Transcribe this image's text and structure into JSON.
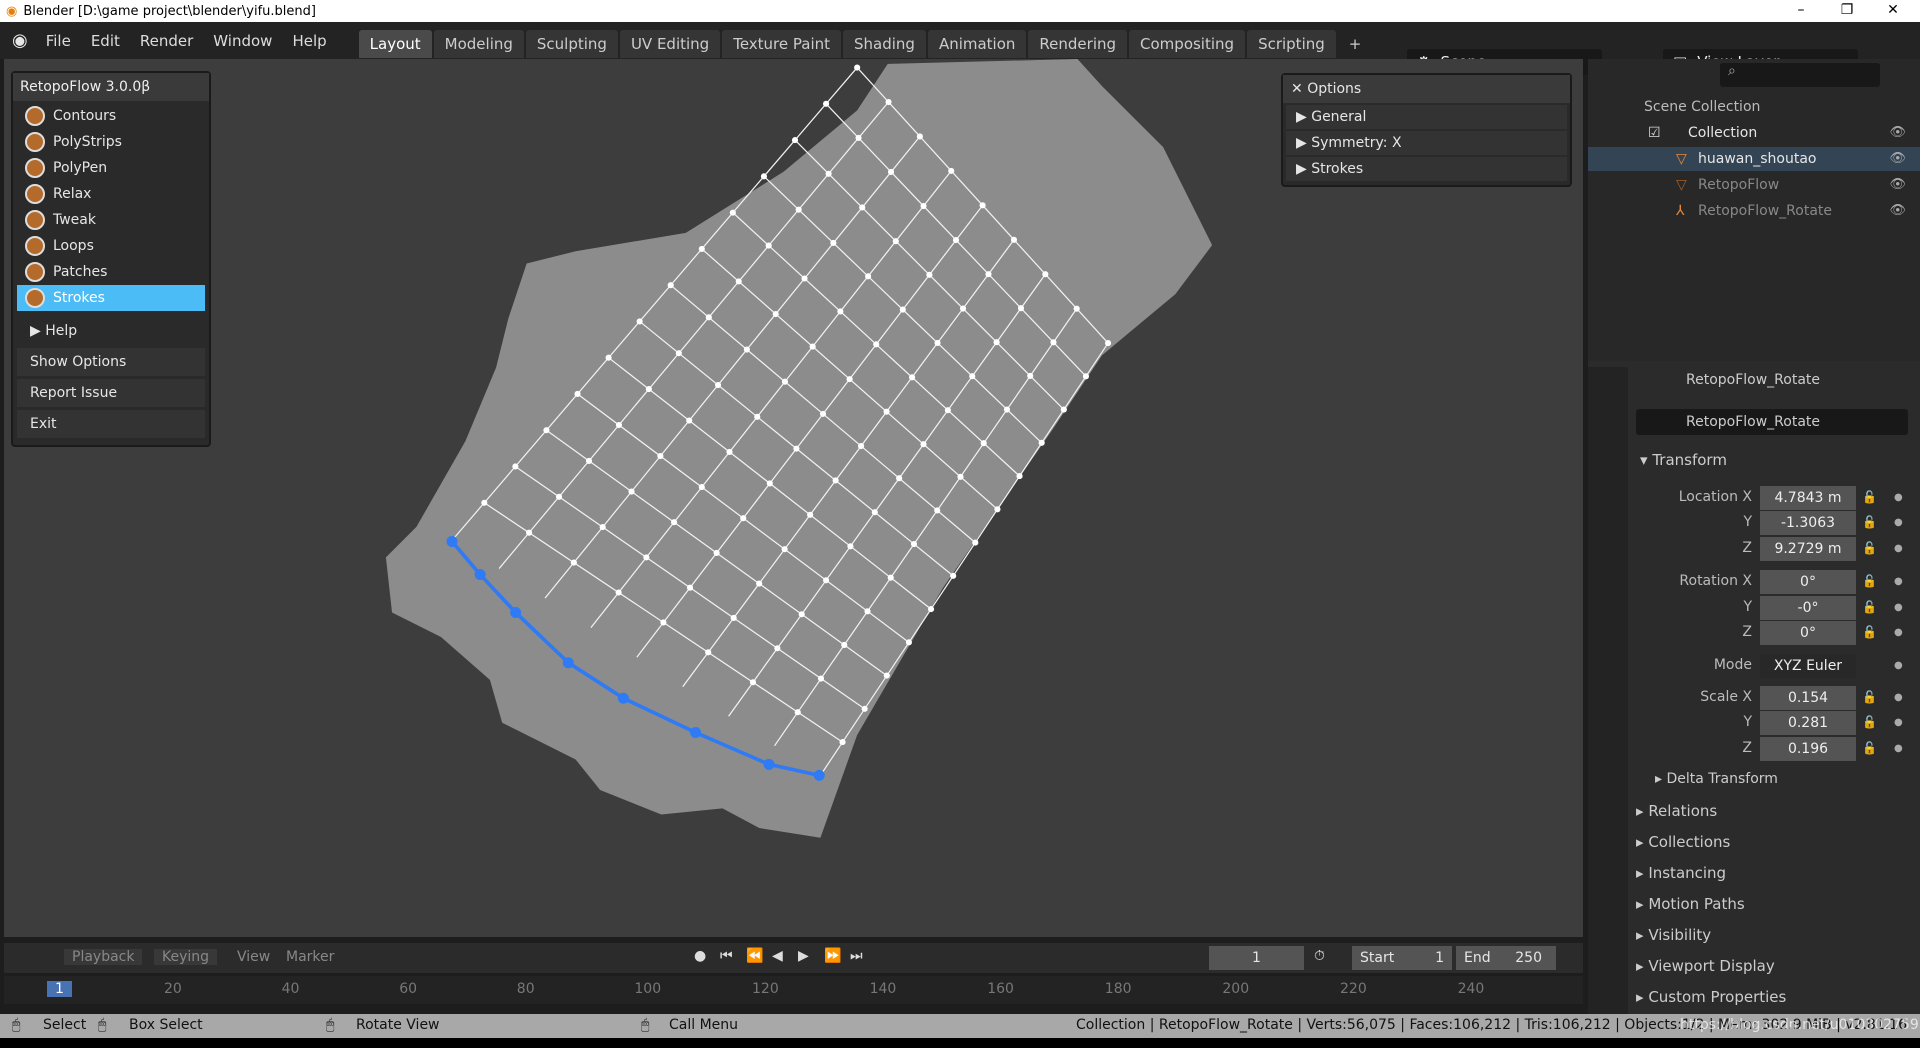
{
  "window": {
    "title": "Blender [D:\\game project\\blender\\yifu.blend]",
    "controls": [
      "–",
      "❐",
      "✕"
    ]
  },
  "menu": [
    "File",
    "Edit",
    "Render",
    "Window",
    "Help"
  ],
  "workspaces": [
    "Layout",
    "Modeling",
    "Sculpting",
    "UV Editing",
    "Texture Paint",
    "Shading",
    "Animation",
    "Rendering",
    "Compositing",
    "Scripting",
    "+"
  ],
  "active_workspace": "Layout",
  "scene": "Scene",
  "view_layer": "View Layer",
  "retopoflow": {
    "title": "RetopoFlow 3.0.0β",
    "tools": [
      "Contours",
      "PolyStrips",
      "PolyPen",
      "Relax",
      "Tweak",
      "Loops",
      "Patches",
      "Strokes"
    ],
    "active_tool": "Strokes",
    "help": "Help",
    "buttons": [
      "Show Options",
      "Report Issue",
      "Exit"
    ],
    "accent": "#4bbcf5"
  },
  "options": {
    "title": "Options",
    "rows": [
      "General",
      "Symmetry: X",
      "Strokes"
    ]
  },
  "outliner": {
    "root": "Scene Collection",
    "items": [
      "Collection",
      "huawan_shoutao",
      "RetopoFlow",
      "RetopoFlow_Rotate"
    ]
  },
  "properties": {
    "object": "RetopoFlow_Rotate",
    "name_field": "RetopoFlow_Rotate",
    "transform": "Transform",
    "location": {
      "label": "Location X",
      "x": "4.7843 m",
      "y": "-1.3063",
      "z": "9.2729 m"
    },
    "rotation": {
      "label": "Rotation X",
      "x": "0°",
      "y": "-0°",
      "z": "0°"
    },
    "mode_label": "Mode",
    "mode": "XYZ Euler",
    "scale": {
      "label": "Scale X",
      "x": "0.154",
      "y": "0.281",
      "z": "0.196"
    },
    "axis": {
      "y": "Y",
      "z": "Z"
    },
    "sections": [
      "Delta Transform",
      "Relations",
      "Collections",
      "Instancing",
      "Motion Paths",
      "Visibility",
      "Viewport Display",
      "Custom Properties"
    ]
  },
  "timeline": {
    "menus": [
      "Playback",
      "Keying",
      "View",
      "Marker"
    ],
    "current_frame": "1",
    "start_label": "Start",
    "start": "1",
    "end_label": "End",
    "end": "250",
    "ticks": [
      "1",
      "20",
      "40",
      "60",
      "80",
      "100",
      "120",
      "140",
      "160",
      "180",
      "200",
      "220",
      "240"
    ]
  },
  "status": {
    "select": "Select",
    "box_select": "Box Select",
    "rotate": "Rotate View",
    "call_menu": "Call Menu",
    "stats": "Collection | RetopoFlow_Rotate | Verts:56,075 | Faces:106,212 | Tris:106,212 | Objects:1/2 | Mem: 302.9 MiB | v2.81.16",
    "watermark": "https://blog.csdn.net/u010302759"
  }
}
